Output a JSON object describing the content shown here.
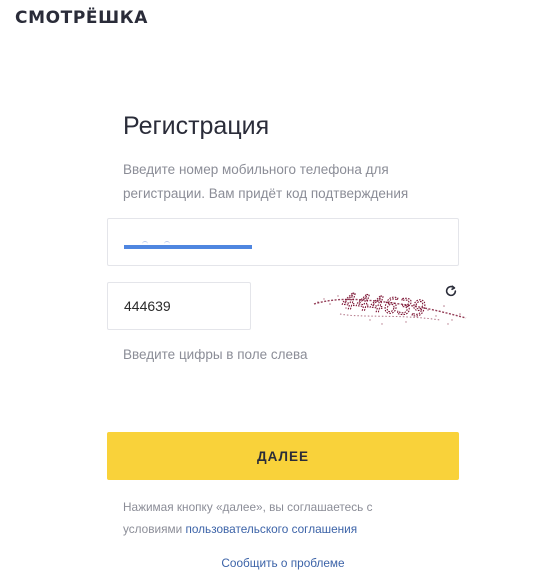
{
  "header": {
    "logo_text": "СМОТРЁШКА"
  },
  "form": {
    "title": "Регистрация",
    "description": "Введите номер мобильного телефона для регистрации. Вам придёт код подтверждения",
    "phone_value": "",
    "captcha_value": "444639",
    "captcha_image_text": "444639",
    "captcha_hint": "Введите цифры в поле слева",
    "next_label": "ДАЛЕЕ",
    "agreement_prefix": "Нажимая кнопку «далее», вы соглашаетесь с условиями ",
    "agreement_link": "пользовательского соглашения",
    "report_link": "Сообщить о проблеме"
  },
  "colors": {
    "accent_yellow": "#f9d23a",
    "link_blue": "#3c63a8",
    "text_dark": "#2a2c39",
    "text_muted": "#8b8d97",
    "captcha_ink": "#7a1030"
  },
  "icons": {
    "refresh": "refresh-icon"
  }
}
